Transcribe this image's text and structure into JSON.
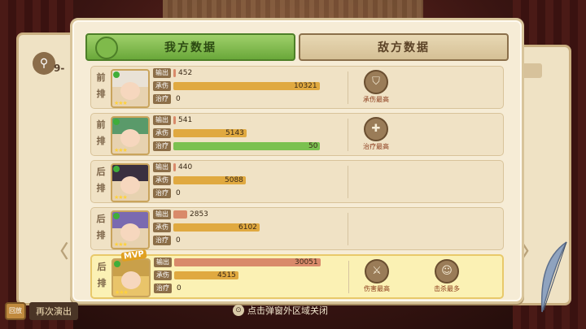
{
  "background": {
    "stage_label": "9-",
    "left_arrow": "〈",
    "right_arrow": "〉"
  },
  "tabs": {
    "mine": "我方数据",
    "enemy": "敌方数据",
    "active": "mine"
  },
  "labels": {
    "output": "输出",
    "tank": "承伤",
    "heal": "治疗"
  },
  "max": {
    "output": 30051,
    "tank": 10321,
    "heal": 50
  },
  "colors": {
    "output": "#d98a6a",
    "tank": "#e0a940",
    "heal": "#7bc150",
    "mvp_row": "#fbf1b4"
  },
  "rows": [
    {
      "pos_top": "前",
      "pos_bottom": "排",
      "output": "452",
      "tank": "10321",
      "heal": "0",
      "output_frac": 0.015,
      "tank_frac": 1.0,
      "heal_frac": 0,
      "mvp": false,
      "hair_color": "#e9e2d6",
      "awards": [
        {
          "label": "承伤最高",
          "icon": "shield-icon",
          "glyph": "⛉"
        }
      ]
    },
    {
      "pos_top": "前",
      "pos_bottom": "排",
      "output": "541",
      "tank": "5143",
      "heal": "50",
      "output_frac": 0.018,
      "tank_frac": 0.498,
      "heal_frac": 1.0,
      "mvp": false,
      "hair_color": "#5a9a6a",
      "awards": [
        {
          "label": "治疗最高",
          "icon": "heal-cross-icon",
          "glyph": "✚"
        }
      ]
    },
    {
      "pos_top": "后",
      "pos_bottom": "排",
      "output": "440",
      "tank": "5088",
      "heal": "0",
      "output_frac": 0.015,
      "tank_frac": 0.493,
      "heal_frac": 0,
      "mvp": false,
      "hair_color": "#3a3040",
      "awards": []
    },
    {
      "pos_top": "后",
      "pos_bottom": "排",
      "output": "2853",
      "tank": "6102",
      "heal": "0",
      "output_frac": 0.095,
      "tank_frac": 0.591,
      "heal_frac": 0,
      "mvp": false,
      "hair_color": "#7a6ab0",
      "awards": []
    },
    {
      "pos_top": "后",
      "pos_bottom": "排",
      "output": "30051",
      "tank": "4515",
      "heal": "0",
      "output_frac": 1.0,
      "tank_frac": 0.437,
      "heal_frac": 0,
      "mvp": true,
      "mvp_label": "MVP",
      "hair_color": "#c9a04a",
      "awards": [
        {
          "label": "伤害最高",
          "icon": "sword-icon",
          "glyph": "⚔"
        },
        {
          "label": "击杀最多",
          "icon": "cat-mask-icon",
          "glyph": "☺"
        }
      ]
    }
  ],
  "footer": {
    "replay_icon": "回放",
    "replay": "再次演出",
    "hint_icon": "⊙",
    "hint": "点击弹窗外区域关闭"
  }
}
